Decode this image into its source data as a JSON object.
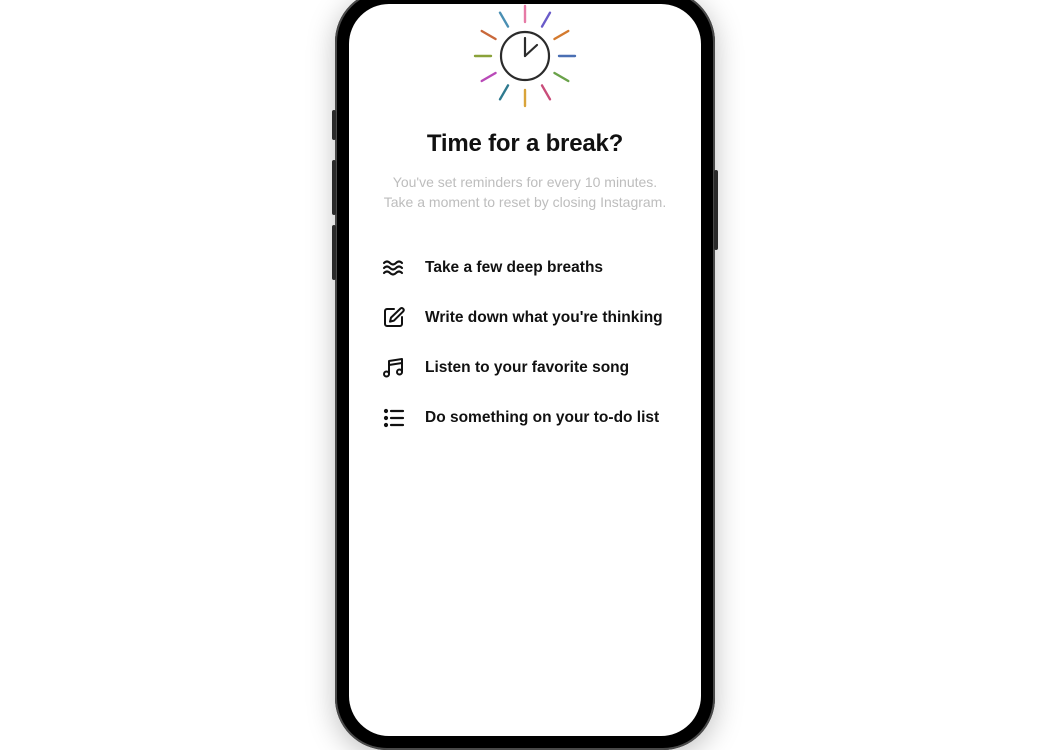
{
  "header": {
    "title": "Time for a break?",
    "subtitle_line1": "You've set reminders for every 10 minutes.",
    "subtitle_line2": "Take a moment to reset by closing Instagram."
  },
  "suggestions": [
    {
      "icon": "breath-icon",
      "label": "Take a few deep breaths"
    },
    {
      "icon": "write-icon",
      "label": "Write down what you're thinking"
    },
    {
      "icon": "music-icon",
      "label": "Listen to your favorite song"
    },
    {
      "icon": "list-icon",
      "label": "Do something on your to-do list"
    }
  ],
  "burst_colors": [
    "#e67aa6",
    "#6a5bc9",
    "#d47a2e",
    "#4a6fb3",
    "#6aa24a",
    "#c94d7a",
    "#d9a43a",
    "#2f7a8f",
    "#b94ab8",
    "#8aa23a",
    "#c9683a",
    "#4a8fb3"
  ]
}
